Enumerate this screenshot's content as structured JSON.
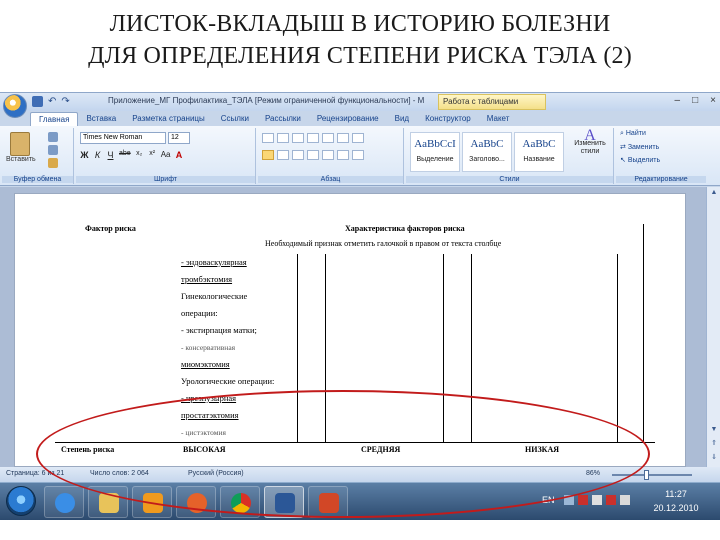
{
  "slide": {
    "title_line1": "ЛИСТОК-ВКЛАДЫШ В ИСТОРИЮ БОЛЕЗНИ",
    "title_line2": "ДЛЯ ОПРЕДЕЛЕНИЯ СТЕПЕНИ РИСКА ТЭЛА (2)"
  },
  "window": {
    "title": "Приложение_МГ Профилактика_ТЭЛА [Режим ограниченной функциональности] - M",
    "context_tab_header": "Работа с таблицами",
    "controls": [
      "–",
      "□",
      "×"
    ]
  },
  "ribbon_tabs": [
    "Главная",
    "Вставка",
    "Разметка страницы",
    "Ссылки",
    "Рассылки",
    "Рецензирование",
    "Вид",
    "Конструктор",
    "Макет"
  ],
  "ribbon": {
    "clipboard": {
      "paste": "Вставить",
      "label": "Буфер обмена"
    },
    "font": {
      "name": "Times New Roman",
      "size": "12",
      "buttons": [
        "Ж",
        "К",
        "Ч",
        "abe",
        "x₂",
        "x²",
        "Aa",
        "A"
      ],
      "label": "Шрифт"
    },
    "paragraph": {
      "label": "Абзац"
    },
    "styles": {
      "tiles": [
        {
          "sample": "AaBbCcI",
          "name": "Выделение"
        },
        {
          "sample": "AaBbC",
          "name": "Заголово..."
        },
        {
          "sample": "AaBbC",
          "name": "Название"
        }
      ],
      "change_styles": "Изменить стили",
      "label": "Стили"
    },
    "editing": {
      "find": "Найти",
      "replace": "Заменить",
      "select": "Выделить",
      "label": "Редактирование"
    }
  },
  "document": {
    "col_header_factor": "Фактор риска",
    "col_header_characteristics": "Характеристика факторов риска",
    "instruction": "Необходимый признак отметить галочкой в правом от текста столбце",
    "risk_items": [
      {
        "text": "- эндоваскулярная",
        "style": "ul"
      },
      {
        "text": "тромбэктомия",
        "style": "ul"
      },
      {
        "text": "Гинекологические",
        "style": ""
      },
      {
        "text": "операции:",
        "style": ""
      },
      {
        "text": "- экстирпация матки;",
        "style": ""
      },
      {
        "text": "- консервативная",
        "style": "gray"
      },
      {
        "text": "миомэктомия",
        "style": "ul"
      },
      {
        "text": "Урологические операции:",
        "style": ""
      },
      {
        "text": "- чрезпузырная",
        "style": "ul"
      },
      {
        "text": "простатэктомия",
        "style": "ul"
      },
      {
        "text": "- цистэктомия",
        "style": "gray"
      }
    ],
    "footer_row": {
      "label": "Степень риска",
      "high": "ВЫСОКАЯ",
      "medium": "СРЕДНЯЯ",
      "low": "НИЗКАЯ"
    }
  },
  "statusbar": {
    "page": "Страница: 6 из 21",
    "words": "Число слов: 2 064",
    "language": "Русский (Россия)",
    "zoom": "86%"
  },
  "taskbar": {
    "lang": "EN",
    "time": "11:27",
    "date": "20.12.2010"
  },
  "colors": {
    "ribbon_blue": "#c7d6ea",
    "annotation_red": "#c21b1b",
    "taskbar": "#2c4a6e"
  }
}
